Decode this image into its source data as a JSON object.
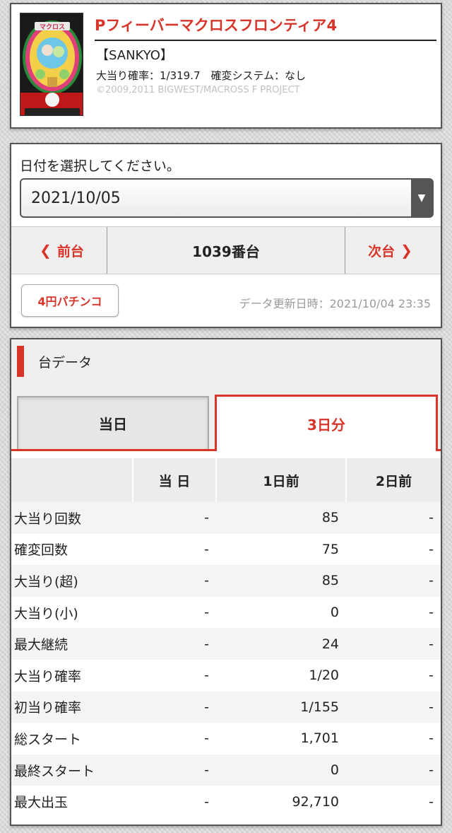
{
  "machine": {
    "title": "Pフィーバーマクロスフロンティア4",
    "maker": "【SANKYO】",
    "probability": "大当り確率：1/319.7　確変システム：なし",
    "copyright": "©2009,2011 BIGWEST/MACROSS F PROJECT",
    "image_caption": "マクロス"
  },
  "date": {
    "label": "日付を選択してください。",
    "selected": "2021/10/05"
  },
  "nav": {
    "prev": "前台",
    "current": "1039番台",
    "next": "次台"
  },
  "badge": "4円パチンコ",
  "update": "データ更新日時：2021/10/04 23:35",
  "section": {
    "title": "台データ"
  },
  "tabs": {
    "today": "当日",
    "three_days": "3日分"
  },
  "table": {
    "headers": [
      "",
      "当 日",
      "1日前",
      "2日前"
    ],
    "rows": [
      {
        "label": "大当り回数",
        "today": "-",
        "d1": "85",
        "d2": "-"
      },
      {
        "label": "確変回数",
        "today": "-",
        "d1": "75",
        "d2": "-"
      },
      {
        "label": "大当り(超)",
        "today": "-",
        "d1": "85",
        "d2": "-"
      },
      {
        "label": "大当り(小)",
        "today": "-",
        "d1": "0",
        "d2": "-"
      },
      {
        "label": "最大継続",
        "today": "-",
        "d1": "24",
        "d2": "-"
      },
      {
        "label": "大当り確率",
        "today": "-",
        "d1": "1/20",
        "d2": "-"
      },
      {
        "label": "初当り確率",
        "today": "-",
        "d1": "1/155",
        "d2": "-"
      },
      {
        "label": "総スタート",
        "today": "-",
        "d1": "1,701",
        "d2": "-"
      },
      {
        "label": "最終スタート",
        "today": "-",
        "d1": "0",
        "d2": "-"
      },
      {
        "label": "最大出玉",
        "today": "-",
        "d1": "92,710",
        "d2": "-"
      }
    ]
  },
  "colors": {
    "accent": "#d8352a",
    "text": "#222222",
    "muted": "#9a9a9a"
  }
}
